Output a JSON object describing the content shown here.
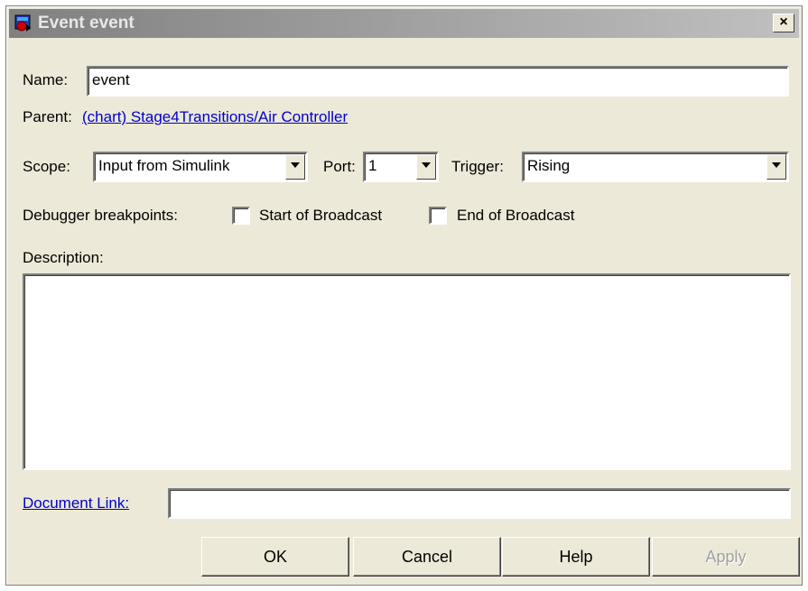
{
  "window": {
    "title": "Event event",
    "close_glyph": "×",
    "icon": "stateflow-event-icon"
  },
  "name": {
    "label": "Name:",
    "value": "event"
  },
  "parent": {
    "label": "Parent:",
    "link_text": "(chart) Stage4Transitions/Air Controller"
  },
  "scope": {
    "label": "Scope:",
    "value": "Input from Simulink"
  },
  "port": {
    "label": "Port:",
    "value": "1"
  },
  "trigger": {
    "label": "Trigger:",
    "value": "Rising"
  },
  "debugger": {
    "label": "Debugger breakpoints:",
    "start_broadcast": {
      "label": "Start of Broadcast",
      "checked": false
    },
    "end_broadcast": {
      "label": "End of Broadcast",
      "checked": false
    }
  },
  "description": {
    "label": "Description:",
    "value": ""
  },
  "document_link": {
    "label": "Document Link:",
    "value": ""
  },
  "buttons": {
    "ok": "OK",
    "cancel": "Cancel",
    "help": "Help",
    "apply": "Apply"
  }
}
